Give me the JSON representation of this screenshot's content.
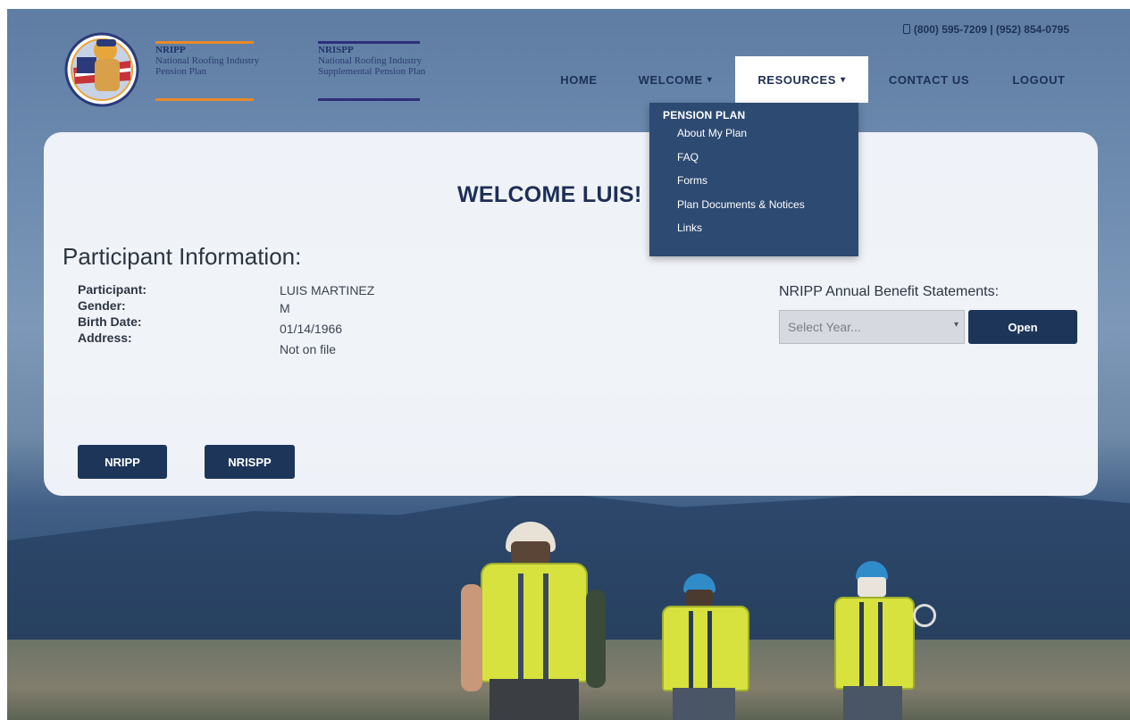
{
  "header": {
    "brand1": {
      "abbr": "NRIPP",
      "line1": "National Roofing Industry",
      "line2": "Pension Plan"
    },
    "brand2": {
      "abbr": "NRISPP",
      "line1": "National Roofing Industry",
      "line2": "Supplemental Pension Plan"
    },
    "phone": "(800) 595-7209 | (952) 854-0795"
  },
  "nav": {
    "home": "HOME",
    "welcome": "WELCOME",
    "resources": "RESOURCES",
    "contact": "CONTACT US",
    "logout": "LOGOUT",
    "caret": "▾"
  },
  "dropdown": {
    "heading": "PENSION PLAN",
    "items": [
      "About My Plan",
      "FAQ",
      "Forms",
      "Plan Documents & Notices",
      "Links"
    ]
  },
  "main": {
    "welcome": "WELCOME LUIS!",
    "section_title": "Participant Information:",
    "fields": [
      {
        "label": "Participant:",
        "value": "LUIS MARTINEZ"
      },
      {
        "label": "Gender:",
        "value": "M"
      },
      {
        "label": "Birth Date:",
        "value": "01/14/1966"
      },
      {
        "label": "Address:",
        "value": "Not on file"
      }
    ],
    "statements_label": "NRIPP Annual Benefit Statements:",
    "select_placeholder": "Select Year...",
    "open_button": "Open",
    "nripp_button": "NRIPP",
    "nrispp_button": "NRISPP"
  },
  "colors": {
    "navy": "#1d2f55",
    "button": "#1d3559",
    "dropdown_bg": "#2d4a72",
    "brand_orange": "#e8892b",
    "brand_purple": "#2e2e7a"
  },
  "icons": {
    "phone": "phone-icon",
    "emblem": "nripp-emblem-logo"
  }
}
